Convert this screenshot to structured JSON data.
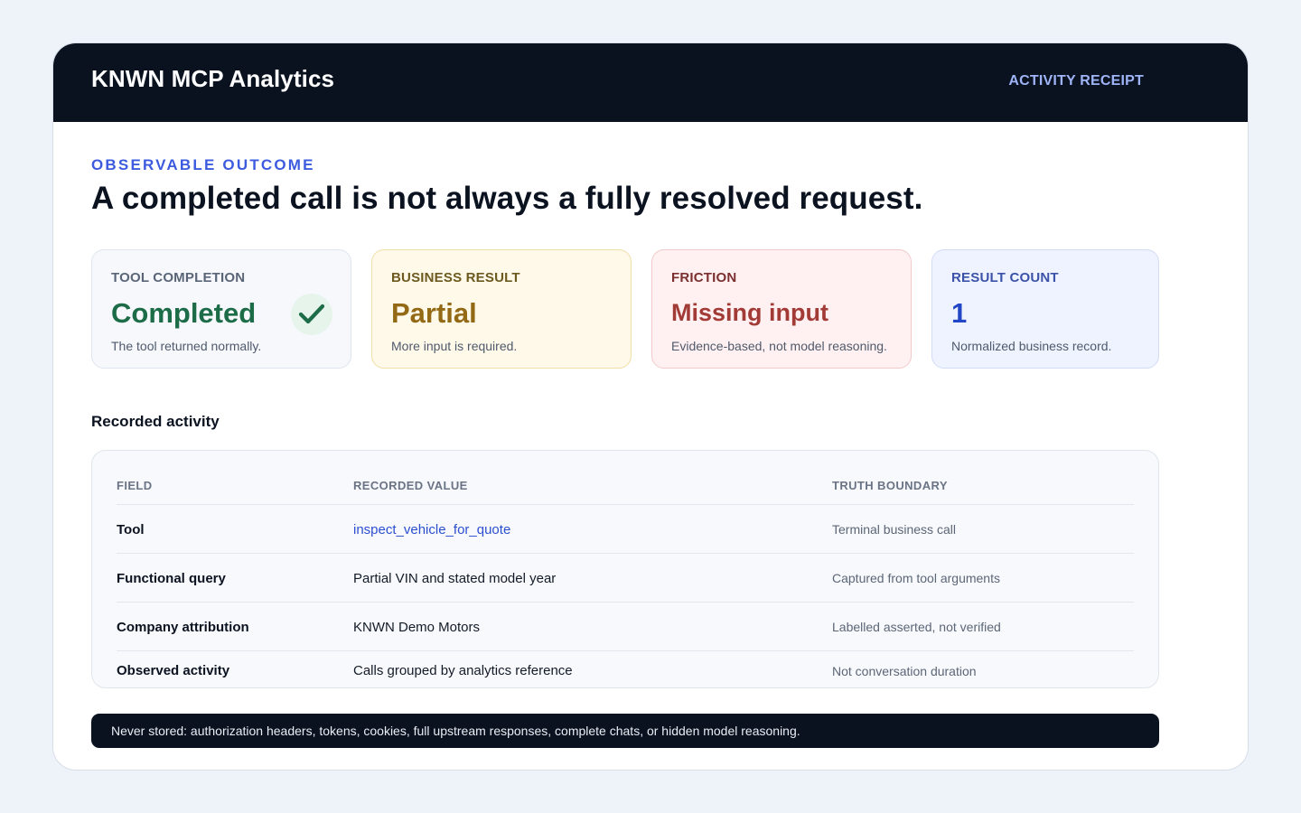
{
  "header": {
    "brand": "KNWN MCP Analytics",
    "badge": "ACTIVITY RECEIPT"
  },
  "intro": {
    "eyebrow": "OBSERVABLE OUTCOME",
    "headline": "A completed call is not always a fully resolved request."
  },
  "stats": [
    {
      "label": "TOOL COMPLETION",
      "value": "Completed",
      "note": "The tool returned normally.",
      "icon": "check-icon",
      "color": "#1c6c48"
    },
    {
      "label": "BUSINESS RESULT",
      "value": "Partial",
      "note": "More input is required.",
      "color": "#946915"
    },
    {
      "label": "FRICTION",
      "value": "Missing input",
      "note": "Evidence-based, not model reasoning.",
      "color": "#a23a36"
    },
    {
      "label": "RESULT COUNT",
      "value": "1",
      "note": "Normalized business record.",
      "color": "#2346c6"
    }
  ],
  "activity": {
    "title": "Recorded activity",
    "columns": [
      "FIELD",
      "RECORDED VALUE",
      "TRUTH BOUNDARY"
    ],
    "rows": [
      {
        "field": "Tool",
        "value": "inspect_vehicle_for_quote",
        "boundary": "Terminal business call"
      },
      {
        "field": "Functional query",
        "value": "Partial VIN and stated model year",
        "boundary": "Captured from tool arguments"
      },
      {
        "field": "Company attribution",
        "value": "KNWN Demo Motors",
        "boundary": "Labelled asserted, not verified"
      },
      {
        "field": "Observed activity",
        "value": "Calls grouped by analytics reference",
        "boundary": "Not conversation duration"
      }
    ]
  },
  "footer": {
    "text": "Never stored: authorization headers, tokens, cookies, full upstream responses, complete chats, or hidden model reasoning."
  }
}
